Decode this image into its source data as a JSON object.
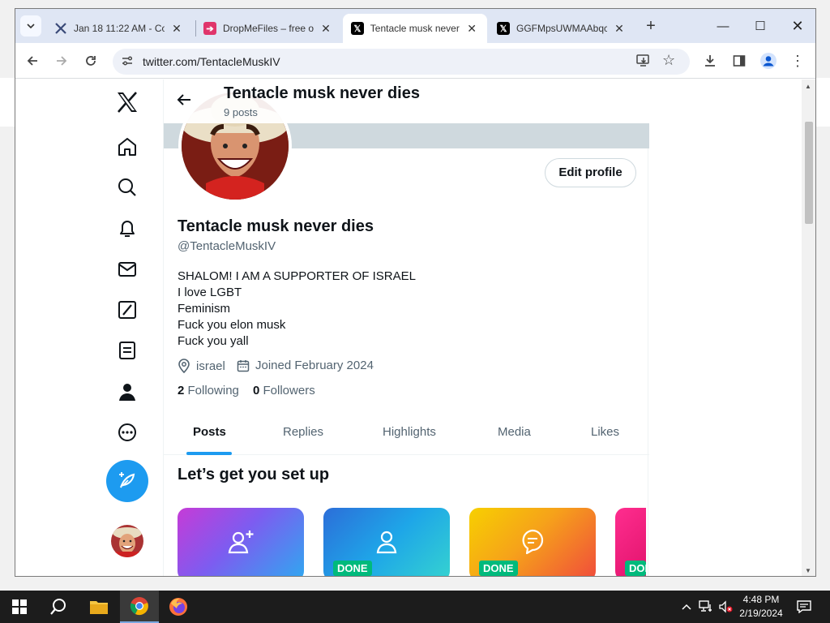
{
  "browser": {
    "tabs": [
      {
        "title": "Jan 18 11:22 AM - Co",
        "favicon": "pinwheel-icon",
        "active": false
      },
      {
        "title": "DropMeFiles – free o",
        "favicon": "dropmefiles-icon",
        "active": false
      },
      {
        "title": "Tentacle musk never",
        "favicon": "x-logo-icon",
        "active": true
      },
      {
        "title": "GGFMpsUWMAAbqc",
        "favicon": "x-logo-icon",
        "active": false
      }
    ],
    "url": "twitter.com/TentacleMuskIV"
  },
  "header": {
    "name": "Tentacle musk never dies",
    "posts_count": "9 posts"
  },
  "profile": {
    "name": "Tentacle musk never dies",
    "handle": "@TentacleMuskIV",
    "edit_label": "Edit profile",
    "bio_lines": [
      "SHALOM! I AM A SUPPORTER OF ISRAEL",
      "I love LGBT",
      "Feminism",
      "Fuck you elon musk",
      "Fuck you yall"
    ],
    "location": "israel",
    "joined": "Joined February 2024",
    "following_count": "2",
    "following_label": "Following",
    "followers_count": "0",
    "followers_label": "Followers"
  },
  "profile_tabs": [
    "Posts",
    "Replies",
    "Highlights",
    "Media",
    "Likes"
  ],
  "selected_tab": "Posts",
  "setup": {
    "title": "Let’s get you set up",
    "done_label": "DONE",
    "cards": [
      {
        "icon": "add-user-icon",
        "done": false
      },
      {
        "icon": "user-icon",
        "done": true
      },
      {
        "icon": "chat-bubble-icon",
        "done": true
      },
      {
        "icon": "unknown-icon",
        "done": true
      }
    ]
  },
  "nav_icons": [
    "x-logo-icon",
    "home-icon",
    "search-icon",
    "bell-icon",
    "mail-icon",
    "grok-icon",
    "lists-icon",
    "profile-icon",
    "more-icon"
  ],
  "taskbar": {
    "time": "4:48 PM",
    "date": "2/19/2024"
  },
  "colors": {
    "accent": "#1d9bf0",
    "done_badge": "#00ba7c",
    "banner": "#cfd9de"
  }
}
